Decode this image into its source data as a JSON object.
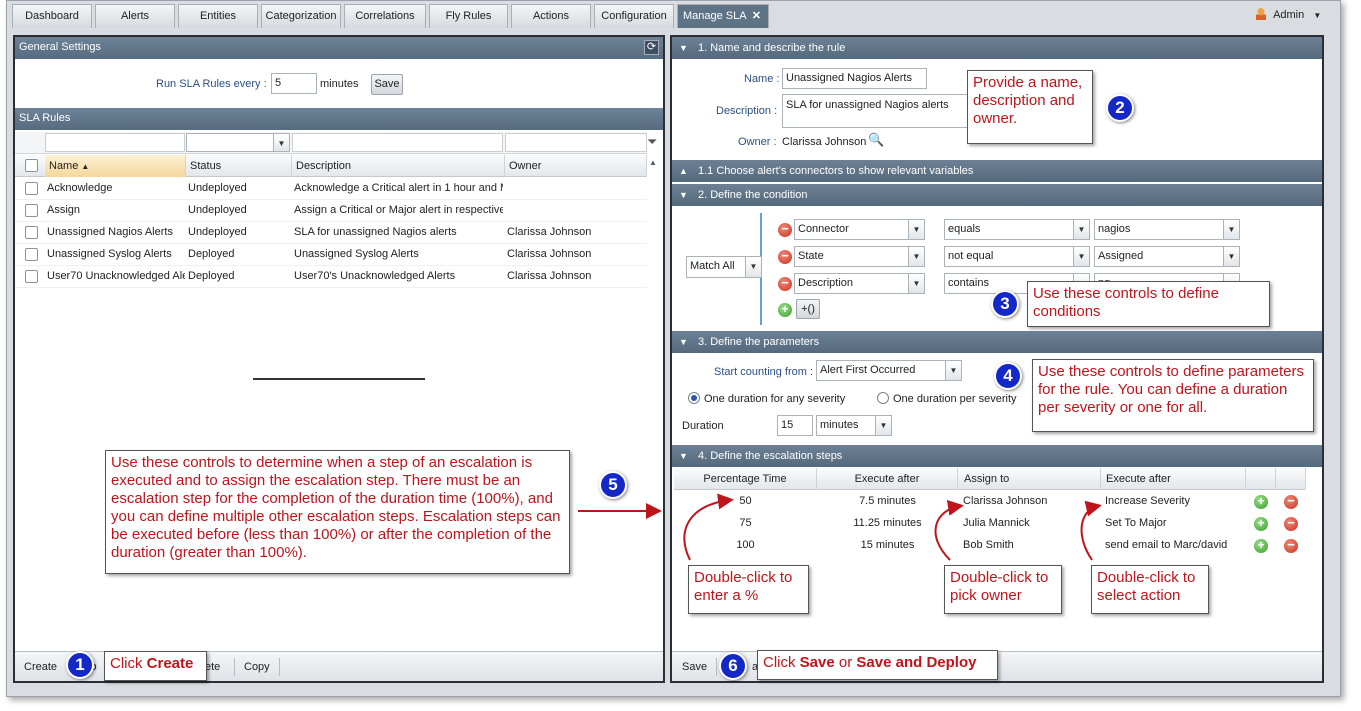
{
  "tabs": [
    {
      "label": "Dashboard"
    },
    {
      "label": "Alerts"
    },
    {
      "label": "Entities"
    },
    {
      "label": "Categorization"
    },
    {
      "label": "Correlations"
    },
    {
      "label": "Fly Rules"
    },
    {
      "label": "Actions"
    },
    {
      "label": "Configuration"
    },
    {
      "label": "Manage SLA"
    }
  ],
  "user": {
    "name": "Admin"
  },
  "left": {
    "general_title": "General Settings",
    "run_label": "Run SLA Rules every :",
    "run_value": "5",
    "run_unit": "minutes",
    "save": "Save",
    "rules_title": "SLA Rules",
    "columns": [
      "Name",
      "Status",
      "Description",
      "Owner"
    ],
    "rows": [
      {
        "name": "Acknowledge",
        "status": "Undeployed",
        "description": "Acknowledge a Critical alert in 1 hour and M",
        "owner": ""
      },
      {
        "name": "Assign",
        "status": "Undeployed",
        "description": "Assign a Critical or Major alert in respective",
        "owner": ""
      },
      {
        "name": "Unassigned Nagios Alerts",
        "status": "Undeployed",
        "description": "SLA for unassigned Nagios alerts",
        "owner": "Clarissa Johnson"
      },
      {
        "name": "Unassigned Syslog Alerts",
        "status": "Deployed",
        "description": "Unassigned Syslog Alerts",
        "owner": "Clarissa Johnson"
      },
      {
        "name": "User70 Unacknowledged Ale",
        "status": "Deployed",
        "description": "User70's Unacknowledged Alerts",
        "owner": "Clarissa Johnson"
      }
    ],
    "footer": {
      "create": "Create",
      "deploy_partial": "lo",
      "delete_partial": "ete",
      "copy": "Copy"
    }
  },
  "right": {
    "s1": "1. Name and describe the rule",
    "name_label": "Name :",
    "name_value": "Unassigned Nagios Alerts",
    "desc_label": "Description :",
    "desc_value": "SLA for unassigned Nagios alerts",
    "owner_label": "Owner :",
    "owner_value": "Clarissa Johnson",
    "s11": "1.1 Choose alert's connectors to show relevant variables",
    "s2": "2. Define the condition",
    "match": "Match All",
    "conditions": [
      {
        "field": "Connector",
        "op": "equals",
        "value": "nagios"
      },
      {
        "field": "State",
        "op": "not equal",
        "value": "Assigned"
      },
      {
        "field": "Description",
        "op": "contains",
        "value": "ng"
      }
    ],
    "group_btn": "+()",
    "s3": "3. Define the parameters",
    "start_label": "Start counting from :",
    "start_value": "Alert First Occurred",
    "radio1": "One duration for any severity",
    "radio2": "One duration per severity",
    "duration_label": "Duration",
    "duration_value": "15",
    "duration_unit": "minutes",
    "s4": "4. Define the escalation steps",
    "esc_columns": [
      "Percentage Time",
      "Execute after",
      "Assign to",
      "Execute after"
    ],
    "esc_rows": [
      {
        "pct": "50",
        "after": "7.5 minutes",
        "assign": "Clarissa Johnson",
        "action": "Increase Severity"
      },
      {
        "pct": "75",
        "after": "11.25 minutes",
        "assign": "Julia Mannick",
        "action": "Set To Major"
      },
      {
        "pct": "100",
        "after": "15 minutes",
        "assign": "Bob Smith",
        "action": "send email to Marc/david"
      }
    ],
    "footer_save": "Save",
    "footer_partial": "a"
  },
  "callouts": {
    "c1_pre": "Click ",
    "c1_bold": "Create",
    "c2": "Provide a name, description and owner.",
    "c3": "Use these controls to define conditions",
    "c4": "Use these controls to define parameters for the rule. You can define a duration per severity or one for all.",
    "c5": "Use these controls to determine when a step of an escalation is executed and to assign the escalation step.  There must be an escalation step for the completion of the duration time (100%), and you can define multiple other escalation steps. Escalation steps can be executed before (less than 100%) or after the completion of the duration (greater than 100%).",
    "c6_pre": "Click ",
    "c6_b1": "Save",
    "c6_mid": " or ",
    "c6_b2": "Save and Deploy",
    "dc1": "Double-click to enter a %",
    "dc2": "Double-click to pick owner",
    "dc3": "Double-click to select action",
    "n1": "1",
    "n2": "2",
    "n3": "3",
    "n4": "4",
    "n5": "5",
    "n6": "6"
  },
  "colors": {
    "accent": "#5f7387",
    "callout_text": "#c0141c",
    "badge": "#1428c8"
  }
}
